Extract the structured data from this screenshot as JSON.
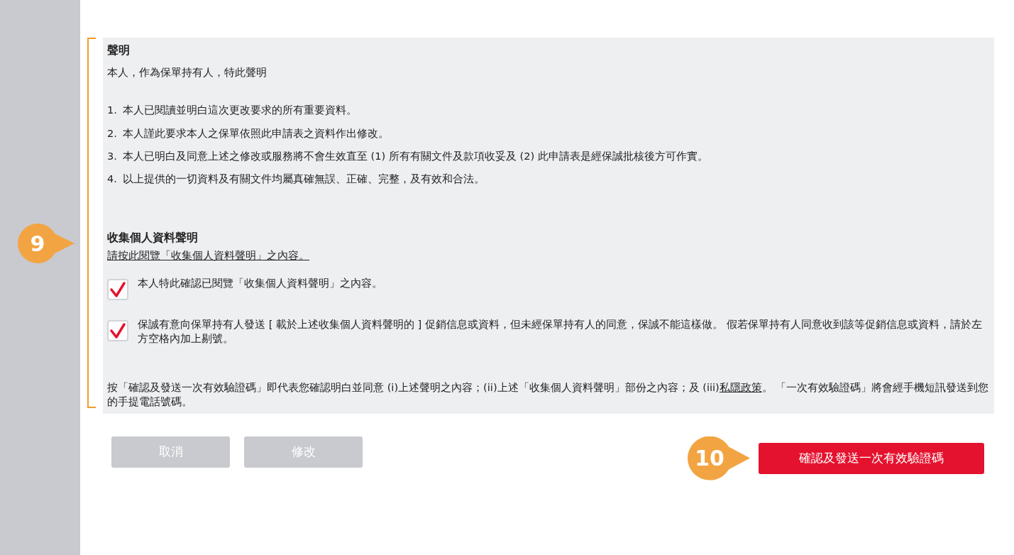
{
  "declaration": {
    "title": "聲明",
    "intro": "本人，作為保單持有人，特此聲明",
    "items": [
      {
        "number": "1.",
        "text": "本人已閱讀並明白這次更改要求的所有重要資料。"
      },
      {
        "number": "2.",
        "text": "本人謹此要求本人之保單依照此申請表之資料作出修改。"
      },
      {
        "number": "3.",
        "text": "本人已明白及同意上述之修改或服務將不會生效直至 (1) 所有有關文件及款項收妥及 (2) 此申請表是經保誠批核後方可作實。"
      },
      {
        "number": "4.",
        "text": "以上提供的一切資料及有關文件均屬真確無誤、正確、完整，及有效和合法。"
      }
    ]
  },
  "pics": {
    "title": "收集個人資料聲明",
    "link": "請按此閱覽「收集個人資料聲明」之內容。",
    "checkboxes": [
      {
        "label": "本人特此確認已閱覽「收集個人資料聲明」之內容。",
        "checked": true
      },
      {
        "label": "保誠有意向保單持有人發送 [ 載於上述收集個人資料聲明的 ] 促銷信息或資料，但未經保單持有人的同意，保誠不能這樣做。 假若保單持有人同意收到該等促銷信息或資料，請於左方空格內加上剔號。",
        "checked": true
      }
    ]
  },
  "consent": {
    "before": "按「確認及發送一次有效驗證碼」即代表您確認明白並同意 (i)上述聲明之內容；(ii)上述「收集個人資料聲明」部份之內容；及 (iii)",
    "link": "私隱政策",
    "after": "。 「一次有效驗證碼」將會經手機短訊發送到您的手提電話號碼。"
  },
  "buttons": [
    {
      "label": "取消",
      "kind": "secondary",
      "disabled": true
    },
    {
      "label": "修改",
      "kind": "secondary",
      "disabled": true
    },
    {
      "label": "確認及發送一次有效驗證碼",
      "kind": "primary",
      "disabled": false
    }
  ],
  "callouts": [
    {
      "label": "9"
    },
    {
      "label": "10"
    }
  ]
}
